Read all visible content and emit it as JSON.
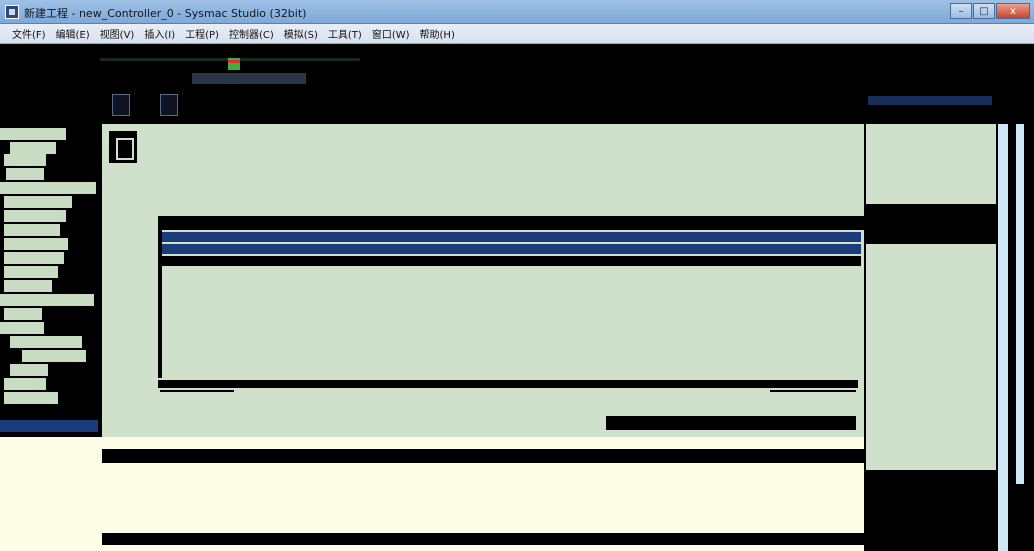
{
  "window": {
    "title": "新建工程 - new_Controller_0 - Sysmac Studio (32bit)",
    "minimize": "–",
    "maximize": "□",
    "close": "x"
  },
  "menu": [
    "文件(F)",
    "编辑(E)",
    "视图(V)",
    "插入(I)",
    "工程(P)",
    "控制器(C)",
    "模拟(S)",
    "工具(T)",
    "窗口(W)",
    "帮助(H)"
  ],
  "colors": {
    "panel": "#cfe0cb",
    "selection": "#1c3b7a",
    "output": "#fdfde6",
    "scroll": "#cfe8f5"
  }
}
